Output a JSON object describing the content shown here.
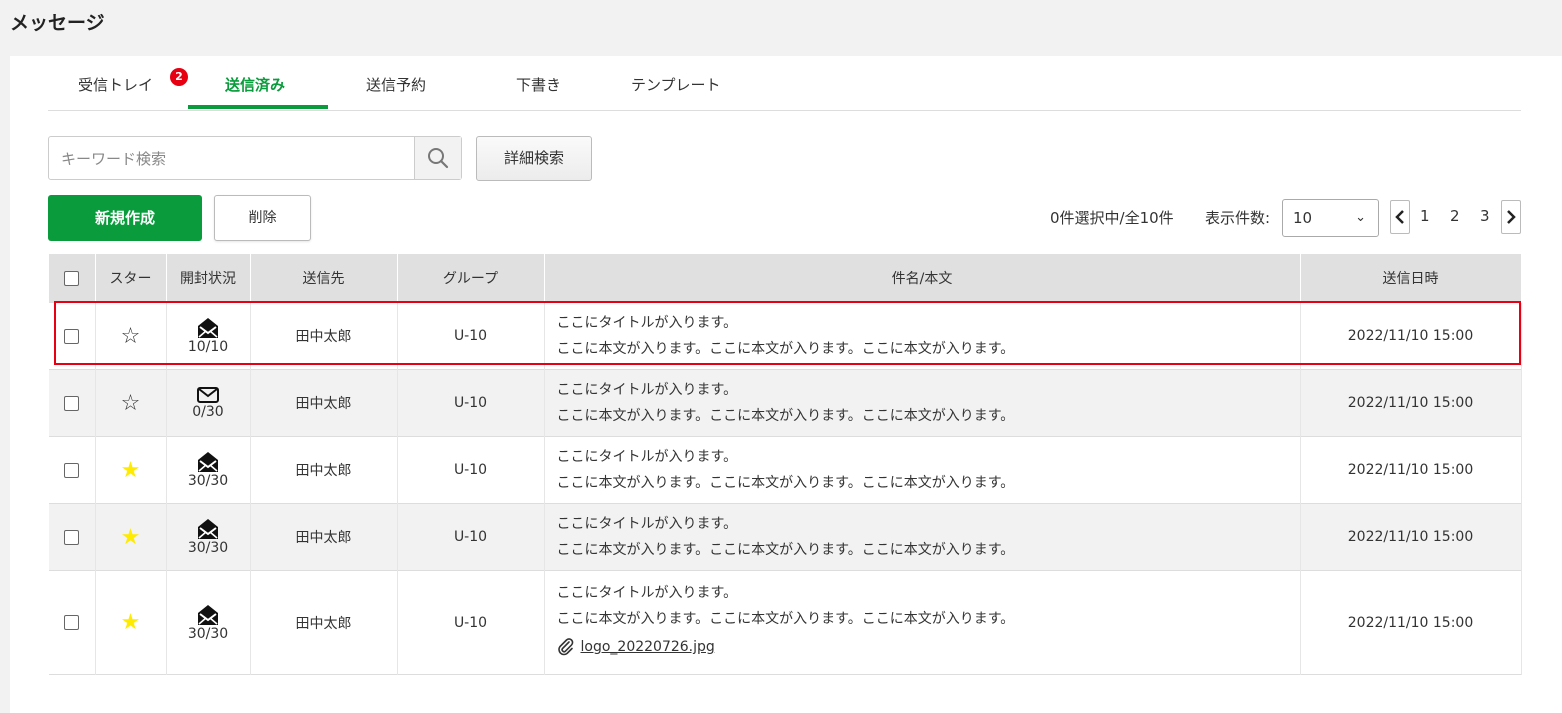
{
  "page": {
    "title": "メッセージ"
  },
  "tabs": [
    {
      "label": "受信トレイ",
      "badge": "2"
    },
    {
      "label": "送信済み",
      "active": true
    },
    {
      "label": "送信予約"
    },
    {
      "label": "下書き"
    },
    {
      "label": "テンプレート"
    }
  ],
  "search": {
    "placeholder": "キーワード検索",
    "advanced_label": "詳細検索"
  },
  "actions": {
    "new_label": "新規作成",
    "delete_label": "削除"
  },
  "listing": {
    "count_text": "0件選択中/全10件",
    "per_page_label": "表示件数:",
    "per_page_value": "10",
    "pages": [
      "1",
      "2",
      "3"
    ]
  },
  "table": {
    "headers": {
      "star": "スター",
      "open": "開封状況",
      "recipient": "送信先",
      "group": "グループ",
      "subject": "件名/本文",
      "date": "送信日時"
    },
    "rows": [
      {
        "starred": false,
        "opened": true,
        "open_count": "10/10",
        "recipient": "田中太郎",
        "group": "U-10",
        "title": "ここにタイトルが入ります。",
        "body": "ここに本文が入ります。ここに本文が入ります。ここに本文が入ります。",
        "date": "2022/11/10 15:00",
        "highlighted": true
      },
      {
        "starred": false,
        "opened": false,
        "open_count": "0/30",
        "recipient": "田中太郎",
        "group": "U-10",
        "title": "ここにタイトルが入ります。",
        "body": "ここに本文が入ります。ここに本文が入ります。ここに本文が入ります。",
        "date": "2022/11/10 15:00"
      },
      {
        "starred": true,
        "opened": true,
        "open_count": "30/30",
        "recipient": "田中太郎",
        "group": "U-10",
        "title": "ここにタイトルが入ります。",
        "body": "ここに本文が入ります。ここに本文が入ります。ここに本文が入ります。",
        "date": "2022/11/10 15:00"
      },
      {
        "starred": true,
        "opened": true,
        "open_count": "30/30",
        "recipient": "田中太郎",
        "group": "U-10",
        "title": "ここにタイトルが入ります。",
        "body": "ここに本文が入ります。ここに本文が入ります。ここに本文が入ります。",
        "date": "2022/11/10 15:00"
      },
      {
        "starred": true,
        "opened": true,
        "open_count": "30/30",
        "recipient": "田中太郎",
        "group": "U-10",
        "title": "ここにタイトルが入ります。",
        "body": "ここに本文が入ります。ここに本文が入ります。ここに本文が入ります。",
        "date": "2022/11/10 15:00",
        "attachment": "logo_20220726.jpg"
      }
    ]
  },
  "colors": {
    "accent": "#0a9c3c",
    "badge": "#e60012",
    "star_on": "#ffeb00",
    "highlight": "#e60012"
  },
  "icons": {
    "search": "search-icon",
    "star": "star-icon",
    "open": "envelope-open-icon",
    "unopened": "envelope-icon",
    "attach": "paperclip-icon",
    "prev": "chevron-left-icon",
    "next": "chevron-right-icon"
  }
}
